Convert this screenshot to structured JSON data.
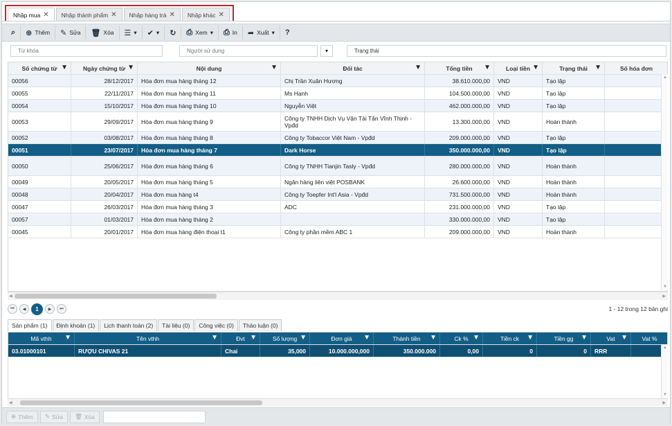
{
  "tabs": [
    {
      "label": "Nhập mua",
      "active": true
    },
    {
      "label": "Nhập thành phẩm"
    },
    {
      "label": "Nhập hàng trả"
    },
    {
      "label": "Nhập khác"
    }
  ],
  "toolbar": {
    "find_icon": "binoculars-icon",
    "add": "Thêm",
    "edit": "Sửa",
    "delete": "Xóa",
    "view": "Xem",
    "print": "In",
    "export": "Xuất"
  },
  "filters": {
    "keyword": "Từ khóa",
    "user": "Người sử dụng",
    "status": "Trạng thái"
  },
  "main_columns": [
    "Số chứng từ",
    "Ngày chứng từ",
    "Nội dung",
    "Đối tác",
    "Tổng tiền",
    "Loại tiền",
    "Trạng thái",
    "Số hóa đơn"
  ],
  "main_rows": [
    {
      "so": "00056",
      "ngay": "28/12/2017",
      "noidung": "Hóa đơn mua hàng tháng 12",
      "doitac": "Chị Trần Xuân Hương",
      "tong": "38.610.000,00",
      "loai": "VND",
      "tt": "Tạo lập",
      "hd": ""
    },
    {
      "so": "00055",
      "ngay": "22/11/2017",
      "noidung": "Hóa đơn mua hàng tháng 11",
      "doitac": "Ms Hạnh",
      "tong": "104.500.000,00",
      "loai": "VND",
      "tt": "Tạo lập",
      "hd": ""
    },
    {
      "so": "00054",
      "ngay": "15/10/2017",
      "noidung": "Hóa đơn mua hàng tháng 10",
      "doitac": "Nguyễn Việt",
      "tong": "462.000.000,00",
      "loai": "VND",
      "tt": "Tạo lập",
      "hd": ""
    },
    {
      "so": "00053",
      "ngay": "29/09/2017",
      "noidung": "Hóa đơn mua hàng tháng 9",
      "doitac": "Công ty TNHH Dịch Vụ Vận Tải Tấn Vĩnh Thịnh - Vpđd",
      "tong": "13.300.000,00",
      "loai": "VND",
      "tt": "Hoàn thành",
      "hd": ""
    },
    {
      "so": "00052",
      "ngay": "03/08/2017",
      "noidung": "Hóa đơn mua hàng tháng 8",
      "doitac": "Công ty Tobaccor Việt Nam - Vpđd",
      "tong": "209.000.000,00",
      "loai": "VND",
      "tt": "Tạo lập",
      "hd": ""
    },
    {
      "so": "00051",
      "ngay": "23/07/2017",
      "noidung": "Hóa đơn mua hàng tháng 7",
      "doitac": "Dark Horse",
      "tong": "350.000.000,00",
      "loai": "VND",
      "tt": "Tạo lập",
      "hd": ""
    },
    {
      "so": "00050",
      "ngay": "25/06/2017",
      "noidung": "Hóa đơn mua hàng tháng 6",
      "doitac": "Công ty TNHH Tianjin Tasly - Vpđd",
      "tong": "280.000.000,00",
      "loai": "VND",
      "tt": "Hoàn thành",
      "hd": ""
    },
    {
      "so": "00049",
      "ngay": "20/05/2017",
      "noidung": "Hóa đơn mua hàng tháng 5",
      "doitac": "Ngân hàng liên việt POSBANK",
      "tong": "26.600.000,00",
      "loai": "VND",
      "tt": "Hoàn thành",
      "hd": ""
    },
    {
      "so": "00048",
      "ngay": "20/04/2017",
      "noidung": "Hóa đơn mua hàng t4",
      "doitac": "Công ty Toepfer Int'l Asia - Vpđd",
      "tong": "731.500.000,00",
      "loai": "VND",
      "tt": "Hoàn thành",
      "hd": ""
    },
    {
      "so": "00047",
      "ngay": "26/03/2017",
      "noidung": "Hóa đơn mua hàng tháng 3",
      "doitac": "ADC",
      "tong": "231.000.000,00",
      "loai": "VND",
      "tt": "Tạo lập",
      "hd": ""
    },
    {
      "so": "00057",
      "ngay": "01/03/2017",
      "noidung": "Hóa đơn mua hàng tháng 2",
      "doitac": "",
      "tong": "330.000.000,00",
      "loai": "VND",
      "tt": "Tạo lập",
      "hd": ""
    },
    {
      "so": "00045",
      "ngay": "20/01/2017",
      "noidung": "Hóa đơn mua hàng điện thoại t1",
      "doitac": "Công ty phần mềm ABC 1",
      "tong": "209.000.000,00",
      "loai": "VND",
      "tt": "Hoàn thành",
      "hd": ""
    }
  ],
  "selected_index": 5,
  "pager": {
    "current": "1",
    "info": "1 - 12 trong 12 bản ghi"
  },
  "subtabs": [
    "Sản phẩm (1)",
    "Định khoản (1)",
    "Lịch thanh toán (2)",
    "Tài liệu (0)",
    "Công việc (0)",
    "Thảo luận (0)"
  ],
  "detail_columns": [
    "Mã vthh",
    "Tên vthh",
    "Đvt",
    "Số lượng",
    "Đơn giá",
    "Thành tiền",
    "Ck %",
    "Tiền ck",
    "Tiền gg",
    "Vat",
    "Vat %"
  ],
  "detail_rows": [
    {
      "ma": "03.01000101",
      "ten": "RƯỢU CHIVAS 21",
      "dvt": "Chai",
      "sl": "35,000",
      "dg": "10.000.000,000",
      "tt": "350.000.000",
      "ck": "0,00",
      "tck": "0",
      "tgg": "0",
      "vat": "RRR",
      "vatp": ""
    }
  ],
  "bottom": {
    "add": "Thêm",
    "edit": "Sửa",
    "delete": "Xóa"
  },
  "colors": {
    "accent": "#135e86",
    "tab_highlight": "#c0262d"
  }
}
